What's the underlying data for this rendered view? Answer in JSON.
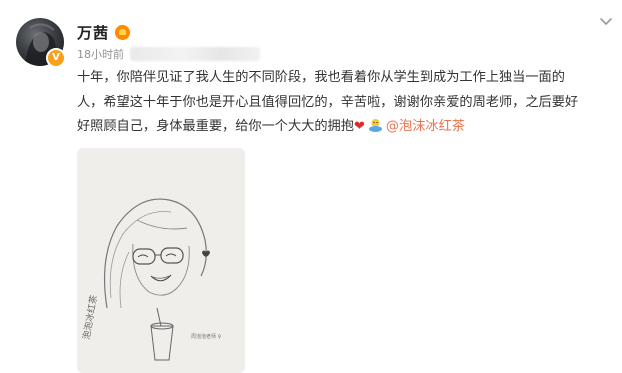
{
  "post": {
    "author": "万茜",
    "timestamp": "18小时前",
    "lines": [
      "十年，你陪伴见证了我人生的不同阶段，我也看着你从学生到成为工作上独当一面的",
      "人，希望这十年于你也是开心且值得回忆的，辛苦啦，谢谢你亲爱的周老师，之后要好",
      "好照顾自己，身体最重要，给你一个大大的拥抱"
    ],
    "heart": "❤",
    "mention": "@泡沫冰红茶"
  },
  "image": {
    "caption_left": "泡泡冰红茶",
    "caption_right": "周泡泡老师 ♀"
  },
  "icons": {
    "avatar": "avatar-photo",
    "verified": "verified-badge-icon",
    "vip": "vip-crown-icon",
    "chevron": "chevron-down-icon",
    "hug": "hug-emoji-icon"
  },
  "colors": {
    "mention": "#eb7350",
    "verified": "#f7a11a",
    "timestamp": "#939393"
  }
}
